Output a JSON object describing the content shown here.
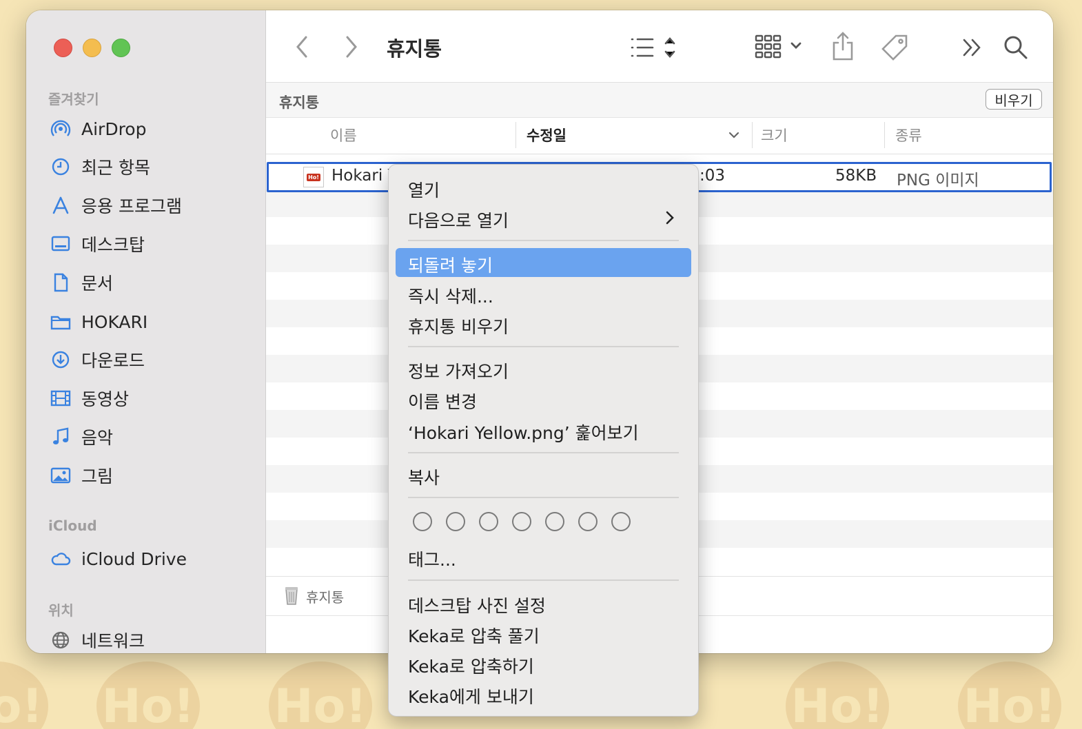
{
  "window": {
    "title": "휴지통"
  },
  "sidebar": {
    "sections": [
      {
        "label": "즐겨찾기"
      },
      {
        "label": "iCloud"
      },
      {
        "label": "위치"
      }
    ],
    "favorites": [
      {
        "label": "AirDrop",
        "icon": "airdrop-icon"
      },
      {
        "label": "최근 항목",
        "icon": "clock-icon"
      },
      {
        "label": "응용 프로그램",
        "icon": "applications-icon"
      },
      {
        "label": "데스크탑",
        "icon": "desktop-icon"
      },
      {
        "label": "문서",
        "icon": "document-icon"
      },
      {
        "label": "HOKARI",
        "icon": "folder-icon"
      },
      {
        "label": "다운로드",
        "icon": "download-icon"
      },
      {
        "label": "동영상",
        "icon": "film-icon"
      },
      {
        "label": "음악",
        "icon": "music-icon"
      },
      {
        "label": "그림",
        "icon": "photo-icon"
      }
    ],
    "icloud": [
      {
        "label": "iCloud Drive",
        "icon": "cloud-icon"
      }
    ],
    "locations": [
      {
        "label": "네트워크",
        "icon": "globe-icon"
      }
    ]
  },
  "pathbar": {
    "title": "휴지통",
    "empty_button": "비우기"
  },
  "columns": {
    "name": "이름",
    "modified": "수정일",
    "size": "크기",
    "kind": "종류"
  },
  "file": {
    "name": "Hokari Y",
    "modified_tail": ":03",
    "size": "58KB",
    "kind": "PNG 이미지",
    "thumb": "Ho!"
  },
  "statusbar": {
    "label": "휴지통"
  },
  "context_menu": {
    "items": [
      {
        "label": "열기"
      },
      {
        "label": "다음으로 열기",
        "submenu": true
      },
      {
        "label": "되돌려 놓기",
        "highlighted": true
      },
      {
        "label": "즉시 삭제..."
      },
      {
        "label": "휴지통 비우기"
      },
      {
        "label": "정보 가져오기"
      },
      {
        "label": "이름 변경"
      },
      {
        "label": "‘Hokari Yellow.png’ 훑어보기"
      },
      {
        "label": "복사"
      },
      {
        "label": "태그..."
      },
      {
        "label": "데스크탑 사진 설정"
      },
      {
        "label": "Keka로 압축 풀기"
      },
      {
        "label": "Keka로 압축하기"
      },
      {
        "label": "Keka에게 보내기"
      }
    ],
    "tag_count": 7
  },
  "wallpaper": {
    "text": "Ho!"
  },
  "colors": {
    "accent": "#2b63cf",
    "menu_highlight": "#6aa3ef",
    "wallpaper": "#f6e5b6"
  }
}
